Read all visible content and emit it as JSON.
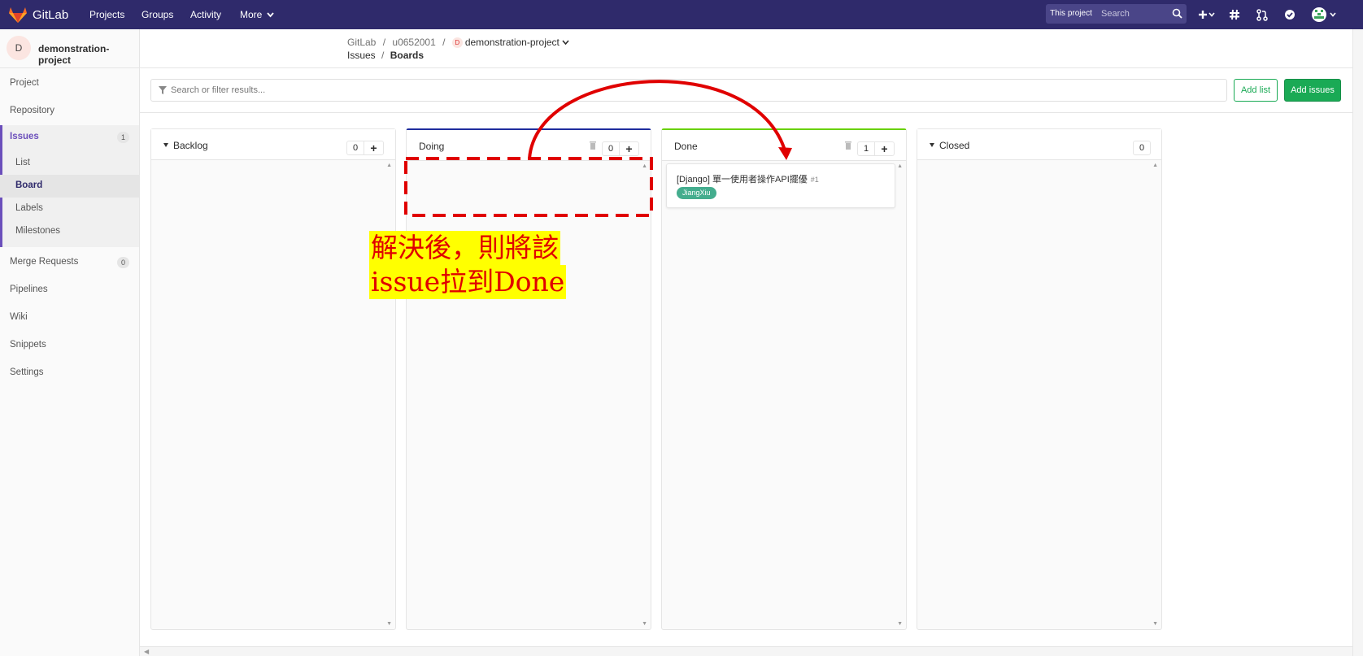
{
  "topbar": {
    "brand": "GitLab",
    "nav": [
      "Projects",
      "Groups",
      "Activity",
      "More"
    ],
    "scope": "This project",
    "search_placeholder": "Search",
    "colors": {
      "bg": "#2f2a6b",
      "logo": "#fc6d26"
    }
  },
  "sidebar": {
    "project_initial": "D",
    "project_name": "demonstration-project",
    "items": {
      "project": "Project",
      "repository": "Repository",
      "issues": "Issues",
      "issues_count": "1",
      "list": "List",
      "board": "Board",
      "labels": "Labels",
      "milestones": "Milestones",
      "merge_requests": "Merge Requests",
      "merge_requests_count": "0",
      "pipelines": "Pipelines",
      "wiki": "Wiki",
      "snippets": "Snippets",
      "settings": "Settings"
    }
  },
  "breadcrumb": {
    "root": "GitLab",
    "sep": "/",
    "user": "u0652001",
    "project_initial": "D",
    "project": "demonstration-project",
    "section": "Issues",
    "page": "Boards"
  },
  "filter": {
    "placeholder": "Search or filter results..."
  },
  "buttons": {
    "add_list": "Add list",
    "add_issues": "Add issues"
  },
  "lists": [
    {
      "title": "Backlog",
      "count": "0",
      "accent": ""
    },
    {
      "title": "Doing",
      "count": "0",
      "accent": "#1f2d9e"
    },
    {
      "title": "Done",
      "count": "1",
      "accent": "#69d100"
    },
    {
      "title": "Closed",
      "count": "0",
      "accent": ""
    }
  ],
  "card": {
    "title": "[Django] 單一使用者操作API擺優",
    "ref": "#1",
    "label": "JiangXiu",
    "label_color": "#44ad8e"
  },
  "annotation": {
    "line1": "解決後，則將該",
    "line2": "issue拉到Done",
    "color": "#e00000",
    "highlight": "#ffff00"
  }
}
